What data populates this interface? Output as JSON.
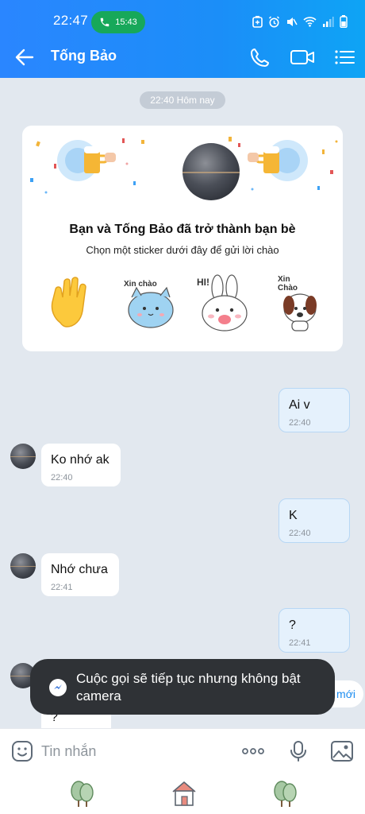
{
  "status_bar": {
    "time": "22:47",
    "call_duration": "15:43",
    "icons": [
      "phone-icon",
      "battery-saver-icon",
      "alarm-icon",
      "mute-icon",
      "wifi-icon",
      "signal-icon",
      "battery-icon"
    ]
  },
  "header": {
    "contact_name": "Tống Bảo",
    "icons": [
      "back-arrow-icon",
      "phone-icon",
      "video-camera-icon",
      "menu-icon"
    ]
  },
  "chat": {
    "date_divider": "22:40 Hôm nay",
    "friend_card": {
      "title": "Bạn và Tống Bảo đã trở thành bạn bè",
      "subtitle": "Chọn một sticker dưới đây để gửi lời chào",
      "stickers": [
        {
          "name": "waving-hand-sticker",
          "text": ""
        },
        {
          "name": "blue-cat-sticker",
          "text": "Xin chào"
        },
        {
          "name": "bunny-sticker",
          "text": "HI!"
        },
        {
          "name": "dog-sticker",
          "text": "Xin Chào"
        }
      ]
    },
    "messages": [
      {
        "side": "me",
        "text": "Ai v",
        "time": "22:40"
      },
      {
        "side": "them",
        "text": "Ko nhớ ak",
        "time": "22:40"
      },
      {
        "side": "me",
        "text": "K",
        "time": "22:40"
      },
      {
        "side": "them",
        "text": "Nhớ chưa",
        "time": "22:41"
      },
      {
        "side": "me",
        "text": "?",
        "time": "22:41"
      },
      {
        "side": "them",
        "text": "?",
        "time": ""
      }
    ],
    "new_messages_pill": "Tin nhắn mới"
  },
  "toast": {
    "text": "Cuộc gọi sẽ tiếp tục nhưng không bật camera"
  },
  "input_bar": {
    "placeholder": "Tin nhắn",
    "icons": [
      "emoji-icon",
      "more-icon",
      "microphone-icon",
      "image-icon"
    ]
  },
  "nav_bar": {
    "icons": [
      "tree-icon",
      "home-icon",
      "tree-icon"
    ]
  },
  "colors": {
    "header_blue": "#1b8ef8",
    "call_green": "#17a85a",
    "my_bubble": "#e5f1fc",
    "chat_bg": "#e2e8ef",
    "toast_bg": "#2f3236"
  }
}
